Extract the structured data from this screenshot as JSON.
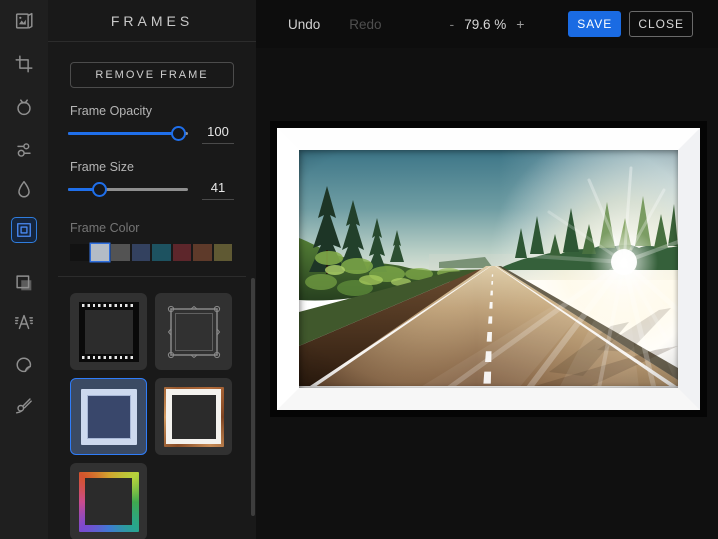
{
  "topbar": {
    "undo_label": "Undo",
    "redo_label": "Redo",
    "zoom_out_label": "-",
    "zoom_value": "79.6 %",
    "zoom_in_label": "+",
    "save_label": "SAVE",
    "close_label": "CLOSE"
  },
  "tool_rail": {
    "tools": [
      {
        "name": "image",
        "active": false
      },
      {
        "name": "crop",
        "active": false
      },
      {
        "name": "adjust",
        "active": false
      },
      {
        "name": "effects",
        "active": false
      },
      {
        "name": "liquify",
        "active": false
      },
      {
        "name": "frames",
        "active": true
      },
      {
        "name": "borders",
        "active": false
      },
      {
        "name": "text",
        "active": false
      },
      {
        "name": "stickers",
        "active": false
      },
      {
        "name": "draw",
        "active": false
      }
    ]
  },
  "panel": {
    "title": "FRAMES",
    "remove_frame_label": "REMOVE FRAME",
    "opacity": {
      "label": "Frame Opacity",
      "value": "100",
      "handle_pct": 92
    },
    "size": {
      "label": "Frame Size",
      "value": "41",
      "handle_pct": 26
    },
    "frame_color": {
      "label": "Frame Color",
      "selected_index": 1,
      "swatches": [
        "#121212",
        "#b4bcc6",
        "#535353",
        "#33415f",
        "#1d5260",
        "#5d262b",
        "#5e3a2a",
        "#5f5933"
      ]
    },
    "frame_styles": [
      {
        "name": "film-strip",
        "selected": false
      },
      {
        "name": "ornate",
        "selected": false
      },
      {
        "name": "classic-matte",
        "selected": true
      },
      {
        "name": "grunge",
        "selected": false
      },
      {
        "name": "rainbow",
        "selected": false
      }
    ]
  },
  "colors": {
    "accent_blue": "#2f6fde",
    "save_blue": "#1a6be3",
    "panel_bg": "#191919",
    "rail_bg": "#1f1f1f",
    "canvas_bg": "#101010"
  }
}
